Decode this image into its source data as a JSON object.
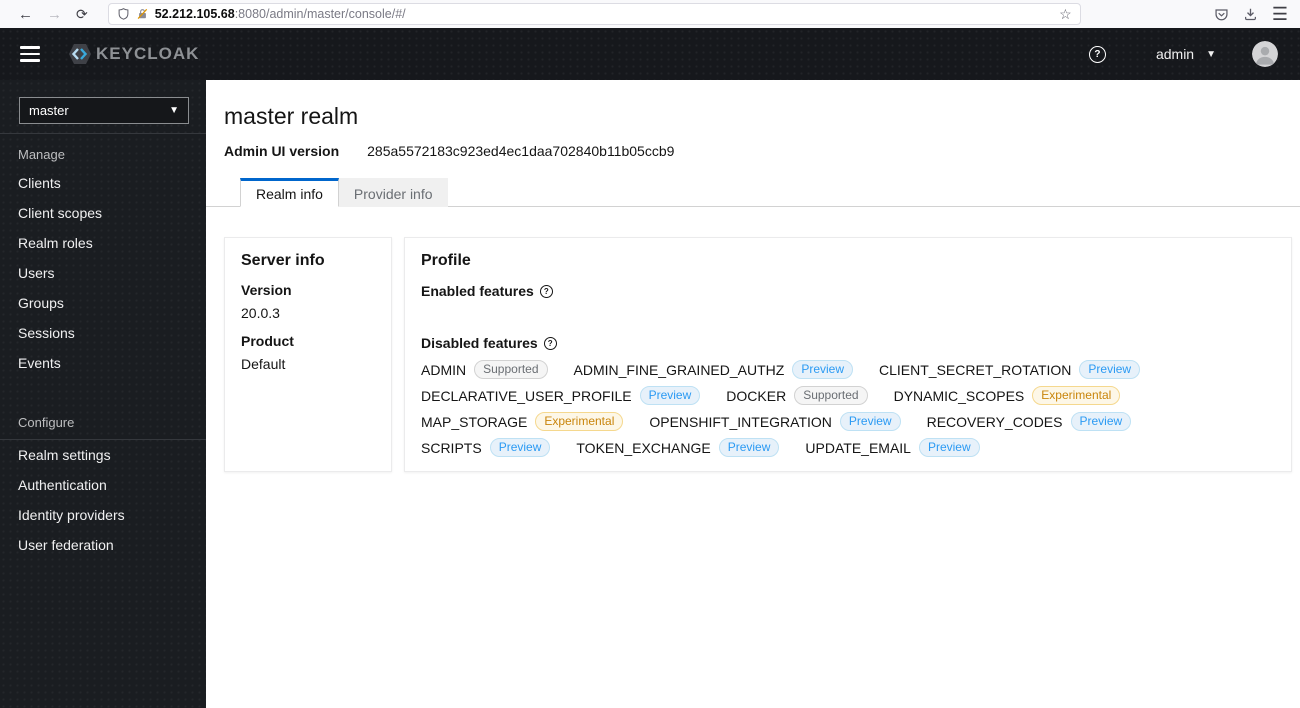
{
  "browser": {
    "url_host": "52.212.105.68",
    "url_path": ":8080/admin/master/console/#/"
  },
  "header": {
    "brand": "KEYCLOAK",
    "username": "admin"
  },
  "sidebar": {
    "realm_selector": "master",
    "groups": [
      {
        "label": "Manage",
        "items": [
          "Clients",
          "Client scopes",
          "Realm roles",
          "Users",
          "Groups",
          "Sessions",
          "Events"
        ]
      },
      {
        "label": "Configure",
        "items": [
          "Realm settings",
          "Authentication",
          "Identity providers",
          "User federation"
        ]
      }
    ]
  },
  "main": {
    "title": "master realm",
    "admin_ui_version_label": "Admin UI version",
    "admin_ui_version_value": "285a5572183c923ed4ec1daa702840b11b05ccb9",
    "tabs": [
      {
        "label": "Realm info",
        "active": true
      },
      {
        "label": "Provider info",
        "active": false
      }
    ],
    "server_info": {
      "title": "Server info",
      "fields": [
        {
          "label": "Version",
          "value": "20.0.3"
        },
        {
          "label": "Product",
          "value": "Default"
        }
      ]
    },
    "profile": {
      "title": "Profile",
      "enabled_label": "Enabled features",
      "disabled_label": "Disabled features",
      "disabled_features": [
        {
          "name": "ADMIN",
          "badge": "Supported",
          "type": "supported"
        },
        {
          "name": "ADMIN_FINE_GRAINED_AUTHZ",
          "badge": "Preview",
          "type": "preview"
        },
        {
          "name": "CLIENT_SECRET_ROTATION",
          "badge": "Preview",
          "type": "preview"
        },
        {
          "name": "DECLARATIVE_USER_PROFILE",
          "badge": "Preview",
          "type": "preview"
        },
        {
          "name": "DOCKER",
          "badge": "Supported",
          "type": "supported"
        },
        {
          "name": "DYNAMIC_SCOPES",
          "badge": "Experimental",
          "type": "experimental"
        },
        {
          "name": "MAP_STORAGE",
          "badge": "Experimental",
          "type": "experimental"
        },
        {
          "name": "OPENSHIFT_INTEGRATION",
          "badge": "Preview",
          "type": "preview"
        },
        {
          "name": "RECOVERY_CODES",
          "badge": "Preview",
          "type": "preview"
        },
        {
          "name": "SCRIPTS",
          "badge": "Preview",
          "type": "preview"
        },
        {
          "name": "TOKEN_EXCHANGE",
          "badge": "Preview",
          "type": "preview"
        },
        {
          "name": "UPDATE_EMAIL",
          "badge": "Preview",
          "type": "preview"
        }
      ]
    }
  },
  "colors": {
    "accent_blue": "#0066cc",
    "masthead_bg": "#16181c",
    "sidebar_bg": "#1a1d21",
    "supported_text": "#6a6e73",
    "supported_bg": "#f5f5f5",
    "preview_text": "#2b9af3",
    "preview_bg": "#e7f1fa",
    "experimental_text": "#c9850c",
    "experimental_bg": "#fdf7e7"
  }
}
